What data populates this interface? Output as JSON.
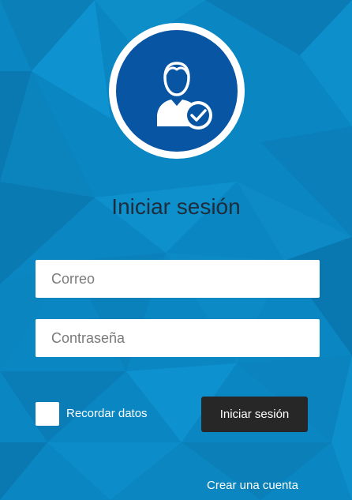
{
  "page": {
    "title": "Iniciar sesión"
  },
  "avatar": {
    "icon": "user-check-icon"
  },
  "form": {
    "email_placeholder": "Correo",
    "password_placeholder": "Contraseña",
    "remember_label": "Recordar datos",
    "remember_checked": false,
    "submit_label": "Iniciar sesión",
    "create_account_label": "Crear una cuenta"
  },
  "colors": {
    "background": "#0a86c2",
    "avatar_disc": "#0755a3",
    "button": "#272727"
  }
}
